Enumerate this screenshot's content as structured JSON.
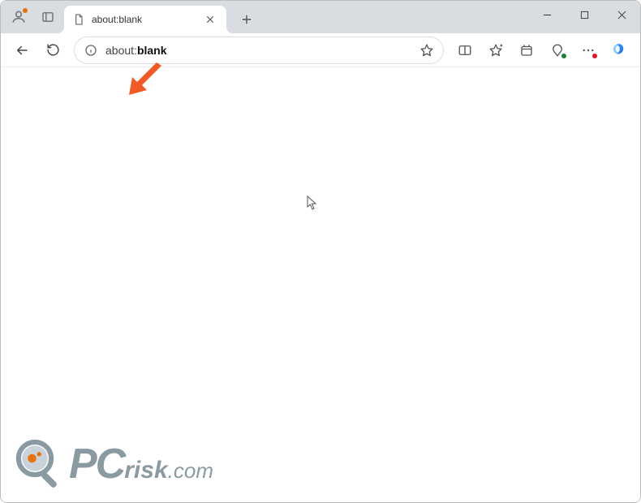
{
  "window": {
    "tab_title": "about:blank",
    "address": {
      "proto": "about:",
      "path": "blank"
    }
  },
  "watermark": {
    "pc": "PC",
    "risk": "risk",
    "com": ".com"
  },
  "colors": {
    "arrow": "#F15A24",
    "tabbar_bg": "#d9dde1"
  }
}
